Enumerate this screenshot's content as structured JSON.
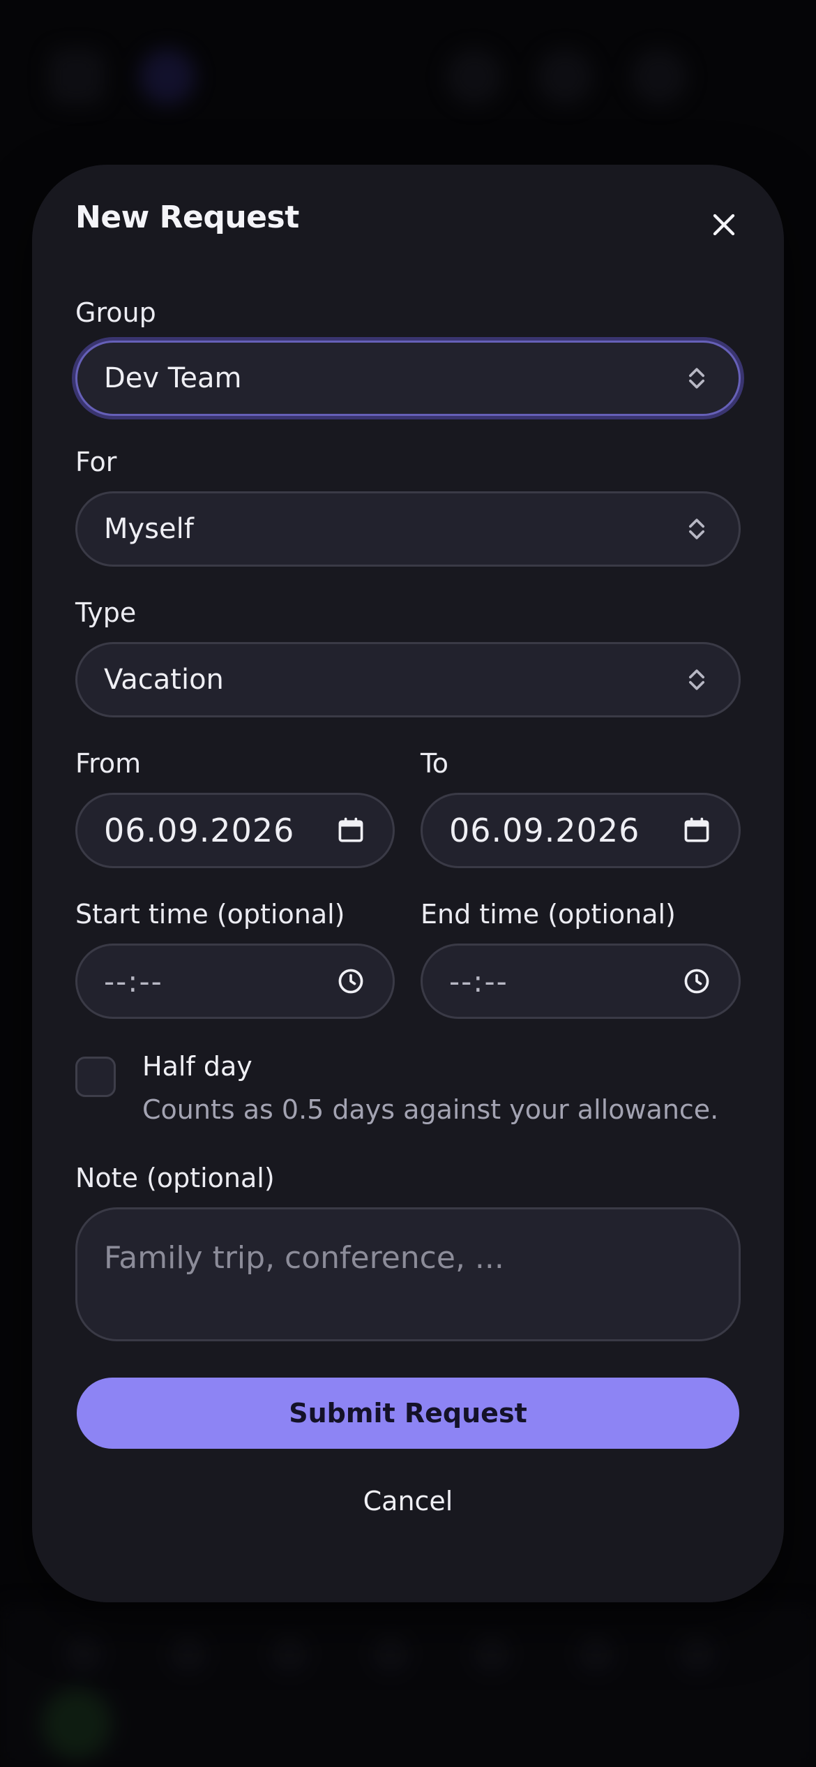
{
  "modal": {
    "title": "New Request",
    "fields": {
      "group": {
        "label": "Group",
        "value": "Dev Team"
      },
      "for": {
        "label": "For",
        "value": "Myself"
      },
      "type": {
        "label": "Type",
        "value": "Vacation"
      },
      "from": {
        "label": "From",
        "value": "06.09.2026"
      },
      "to": {
        "label": "To",
        "value": "06.09.2026"
      },
      "start_time": {
        "label": "Start time (optional)",
        "value": "--:--"
      },
      "end_time": {
        "label": "End time (optional)",
        "value": "--:--"
      },
      "half_day": {
        "label": "Half day",
        "description": "Counts as 0.5 days against your allowance.",
        "checked": false
      },
      "note": {
        "label": "Note (optional)",
        "placeholder": "Family trip, conference, ..."
      }
    },
    "buttons": {
      "submit": "Submit Request",
      "cancel": "Cancel"
    }
  },
  "colors": {
    "accent": "#8d84f4",
    "focus_ring": "#6660b8",
    "modal_bg": "#18181f",
    "field_bg": "#22222d"
  },
  "icons": [
    "close-icon",
    "chevron-updown-icon",
    "calendar-icon",
    "clock-icon"
  ]
}
